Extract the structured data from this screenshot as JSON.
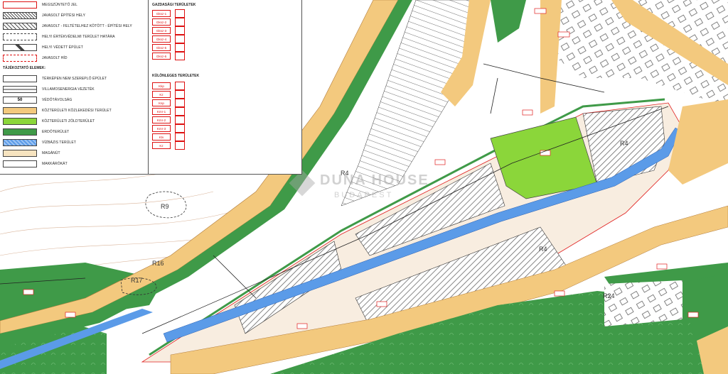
{
  "legend": {
    "rows": [
      {
        "label": "MEGSZÜNTETŐ JEL",
        "swatch": "marker"
      },
      {
        "label": "JAVASOLT ÉPÍTÉSI HELY",
        "swatch": "hatch"
      },
      {
        "label": "JAVASOLT - FELTÉTELHEZ KÖTÖTT - ÉPÍTÉSI HELY",
        "swatch": "dashhatch"
      },
      {
        "label": "HELYI ÉRTÉKVÉDELMI TERÜLET HATÁRA",
        "swatch": "dotline"
      },
      {
        "label": "HELYI VÉDETT ÉPÜLET",
        "swatch": "xbox"
      },
      {
        "label": "JAVASOLT HÍD",
        "swatch": "redlines"
      }
    ],
    "info_header": "TÁJÉKOZTATÓ ELEMEK:",
    "info_rows": [
      {
        "label": "TÉRKÉPEN NEM SZEREPLŐ ÉPÜLET",
        "swatch": "redbox"
      },
      {
        "label": "VILLAMOSENERGIA VEZETÉK",
        "swatch": "powerline"
      },
      {
        "label": "VÉDŐTÁVOLSÁG",
        "swatch": "dist",
        "value": "50"
      },
      {
        "label": "KÖZTERÜLETI KÖZLEKEDÉSI TERÜLET",
        "swatch": "road"
      },
      {
        "label": "KÖZTERÜLETI ZÖLDTERÜLET",
        "swatch": "green"
      },
      {
        "label": "ERDŐTERÜLET",
        "swatch": "forest"
      },
      {
        "label": "VÍZBÁZIS TERÜLET",
        "swatch": "water"
      },
      {
        "label": "MAGÁNÚT",
        "swatch": "private"
      },
      {
        "label": "MAKKÁRÓKÁT",
        "swatch": "white"
      }
    ],
    "right_header": "GAZDASÁGI TERÜLETEK",
    "right_zones": [
      "Gksz-1",
      "Gksz-2",
      "Gksz-3",
      "Gksz-4",
      "Gksz-5",
      "Gksz-6"
    ],
    "right_header2": "KÜLÖNLEGES TERÜLETEK",
    "right_zones2": [
      "Kkp",
      "Kz",
      "Ksp",
      "Kmr-1",
      "Kmr-2",
      "Kmr-3",
      "Ktv",
      "Kz"
    ]
  },
  "map_labels": {
    "r9": "R9",
    "r16": "R16",
    "r17": "R17",
    "r4_upper": "R4",
    "r4_center": "R4",
    "r4_lower": "R4",
    "r24": "R24"
  },
  "watermark": {
    "title": "DUNA HOUSE",
    "subtitle": "BUDAPEST"
  },
  "colors": {
    "road": "#f3c97e",
    "forest": "#3f9a48",
    "park": "#8bd63a",
    "water": "#5b9be8",
    "hatch": "#555555",
    "boundary": "#e02020"
  }
}
